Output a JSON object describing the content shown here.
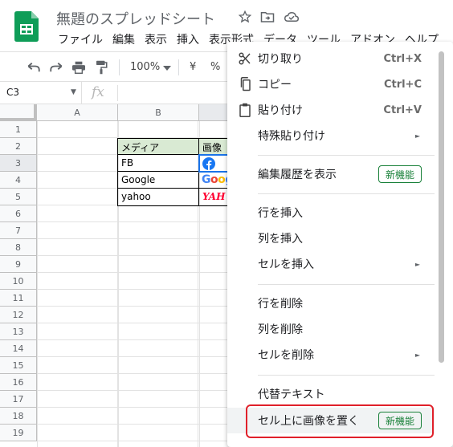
{
  "app": {
    "title": "無題のスプレッドシート",
    "menu": [
      "ファイル",
      "編集",
      "表示",
      "挿入",
      "表示形式",
      "データ",
      "ツール",
      "アドオン",
      "ヘルプ"
    ],
    "title_icons": [
      "star-icon",
      "move-folder-icon",
      "cloud-status-icon"
    ]
  },
  "toolbar": {
    "zoom": "100%",
    "currency": "¥",
    "percent": "%"
  },
  "formula_bar": {
    "name_box": "C3",
    "fx": "fx"
  },
  "grid": {
    "columns": [
      "A",
      "B",
      "C"
    ],
    "rows": [
      "1",
      "2",
      "3",
      "4",
      "5",
      "6",
      "7",
      "8",
      "9",
      "10",
      "11",
      "12",
      "13",
      "14",
      "15",
      "16",
      "17",
      "18",
      "19"
    ],
    "table": {
      "header_media": "メディア",
      "header_image": "画像",
      "rows": [
        "FB",
        "Google",
        "yahoo"
      ],
      "images": [
        "Facebook",
        "Google",
        "YAHOO!"
      ]
    }
  },
  "context_menu": {
    "cut": {
      "label": "切り取り",
      "shortcut": "Ctrl+X"
    },
    "copy": {
      "label": "コピー",
      "shortcut": "Ctrl+C"
    },
    "paste": {
      "label": "貼り付け",
      "shortcut": "Ctrl+V"
    },
    "paste_special": {
      "label": "特殊貼り付け"
    },
    "edit_history": {
      "label": "編集履歴を表示",
      "badge": "新機能"
    },
    "insert_row": {
      "label": "行を挿入"
    },
    "insert_column": {
      "label": "列を挿入"
    },
    "insert_cells": {
      "label": "セルを挿入"
    },
    "delete_row": {
      "label": "行を削除"
    },
    "delete_column": {
      "label": "列を削除"
    },
    "delete_cells": {
      "label": "セルを削除"
    },
    "alt_text": {
      "label": "代替テキスト"
    },
    "place_image_over_cells": {
      "label": "セル上に画像を置く",
      "badge": "新機能"
    }
  },
  "colors": {
    "accent_green": "#188038",
    "header_fill": "#d9ead3",
    "highlight_red": "#e0202a",
    "selection_blue": "#1a73e8"
  }
}
